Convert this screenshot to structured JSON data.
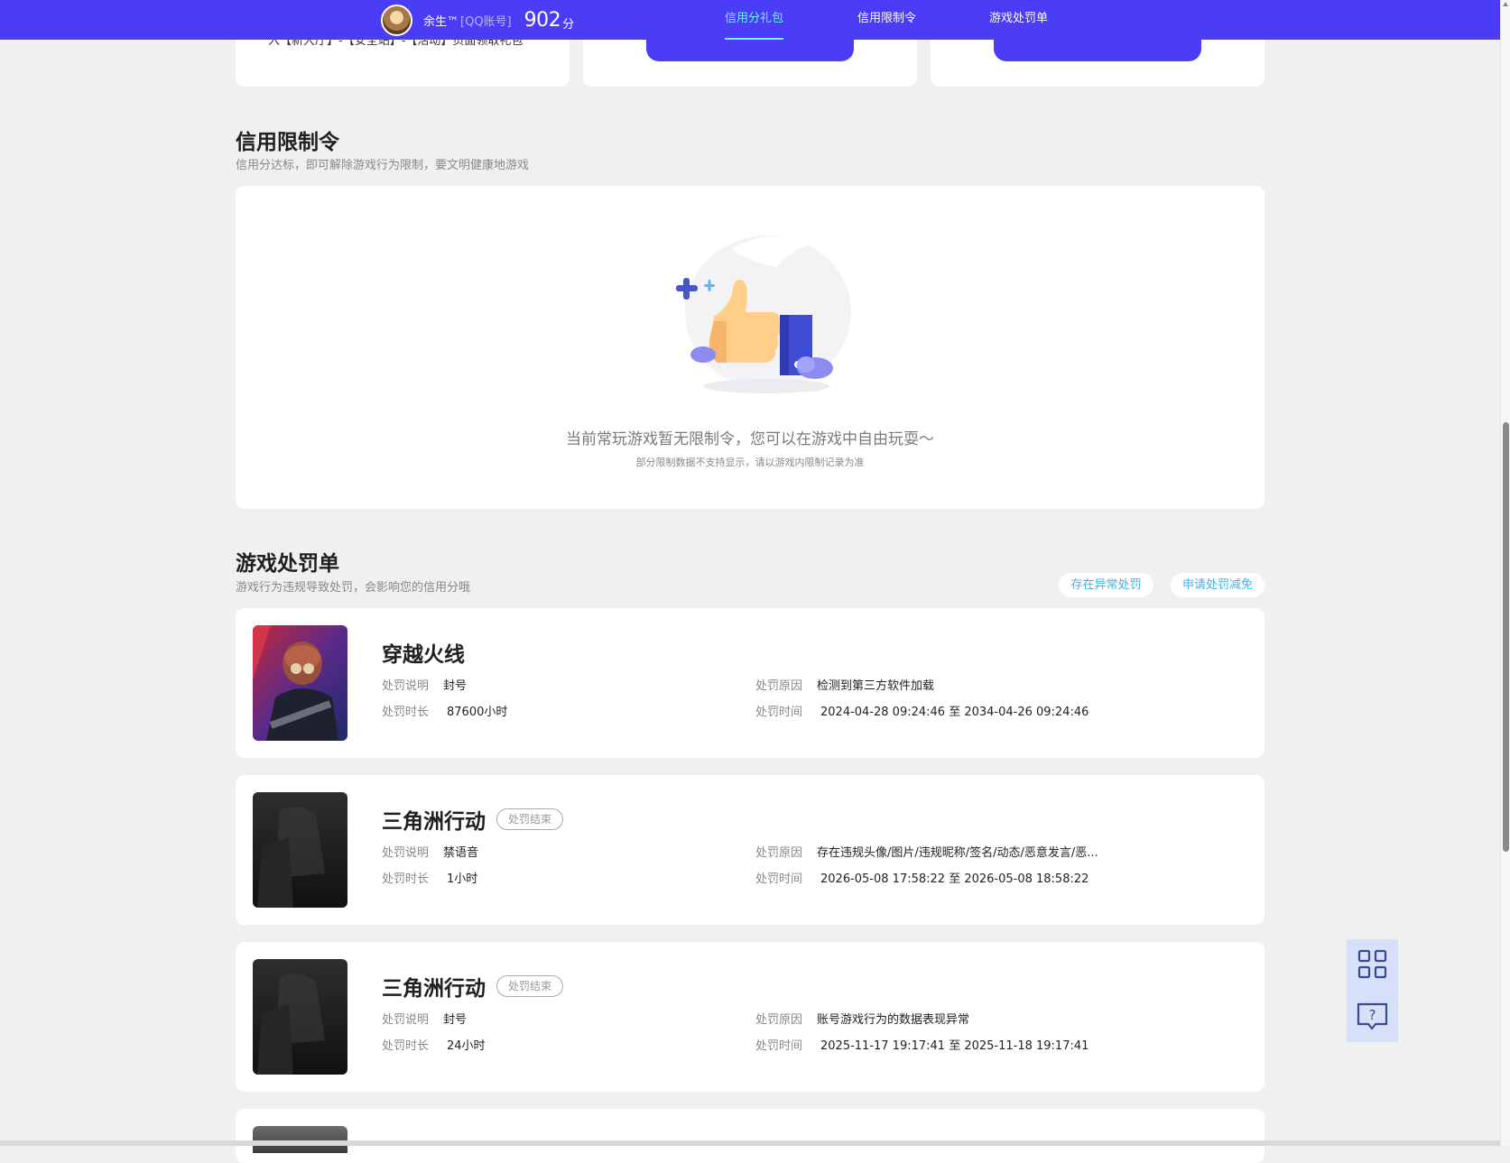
{
  "header": {
    "user_name": "余生™",
    "account_type": "[QQ账号]",
    "score": "902",
    "score_unit": "分",
    "nav": [
      "信用分礼包",
      "信用限制令",
      "游戏处罚单"
    ]
  },
  "top_cards": {
    "left_text": "入【新大厅】-【安全站】-【活动】页面领取礼包"
  },
  "restriction": {
    "title": "信用限制令",
    "subtitle": "信用分达标，即可解除游戏行为限制，要文明健康地游戏",
    "empty_main": "当前常玩游戏暂无限制令，您可以在游戏中自由玩耍～",
    "empty_sub": "部分限制数据不支持显示，请以游戏内限制记录为准"
  },
  "penalty": {
    "title": "游戏处罚单",
    "subtitle": "游戏行为违规导致处罚，会影响您的信用分哦",
    "btn_abnormal": "存在异常处罚",
    "btn_appeal": "申请处罚减免",
    "labels": {
      "desc": "处罚说明",
      "duration": "处罚时长",
      "reason": "处罚原因",
      "time": "处罚时间"
    },
    "items": [
      {
        "game": "穿越火线",
        "badge": "",
        "desc": "封号",
        "duration": "87600小时",
        "reason": "检测到第三方软件加载",
        "time": "2024-04-28 09:24:46 至 2034-04-26 09:24:46"
      },
      {
        "game": "三角洲行动",
        "badge": "处罚结束",
        "desc": "禁语音",
        "duration": "1小时",
        "reason": "存在违规头像/图片/违规昵称/签名/动态/恶意发言/恶...",
        "time": "2026-05-08 17:58:22 至 2026-05-08 18:58:22"
      },
      {
        "game": "三角洲行动",
        "badge": "处罚结束",
        "desc": "封号",
        "duration": "24小时",
        "reason": "账号游戏行为的数据表现异常",
        "time": "2025-11-17 19:17:41 至 2025-11-18 19:17:41"
      }
    ]
  },
  "colors": {
    "brand": "#4b3cf5",
    "nav_active": "#6ff0ff",
    "link": "#3fb2f0",
    "background": "#f0f0f0"
  }
}
